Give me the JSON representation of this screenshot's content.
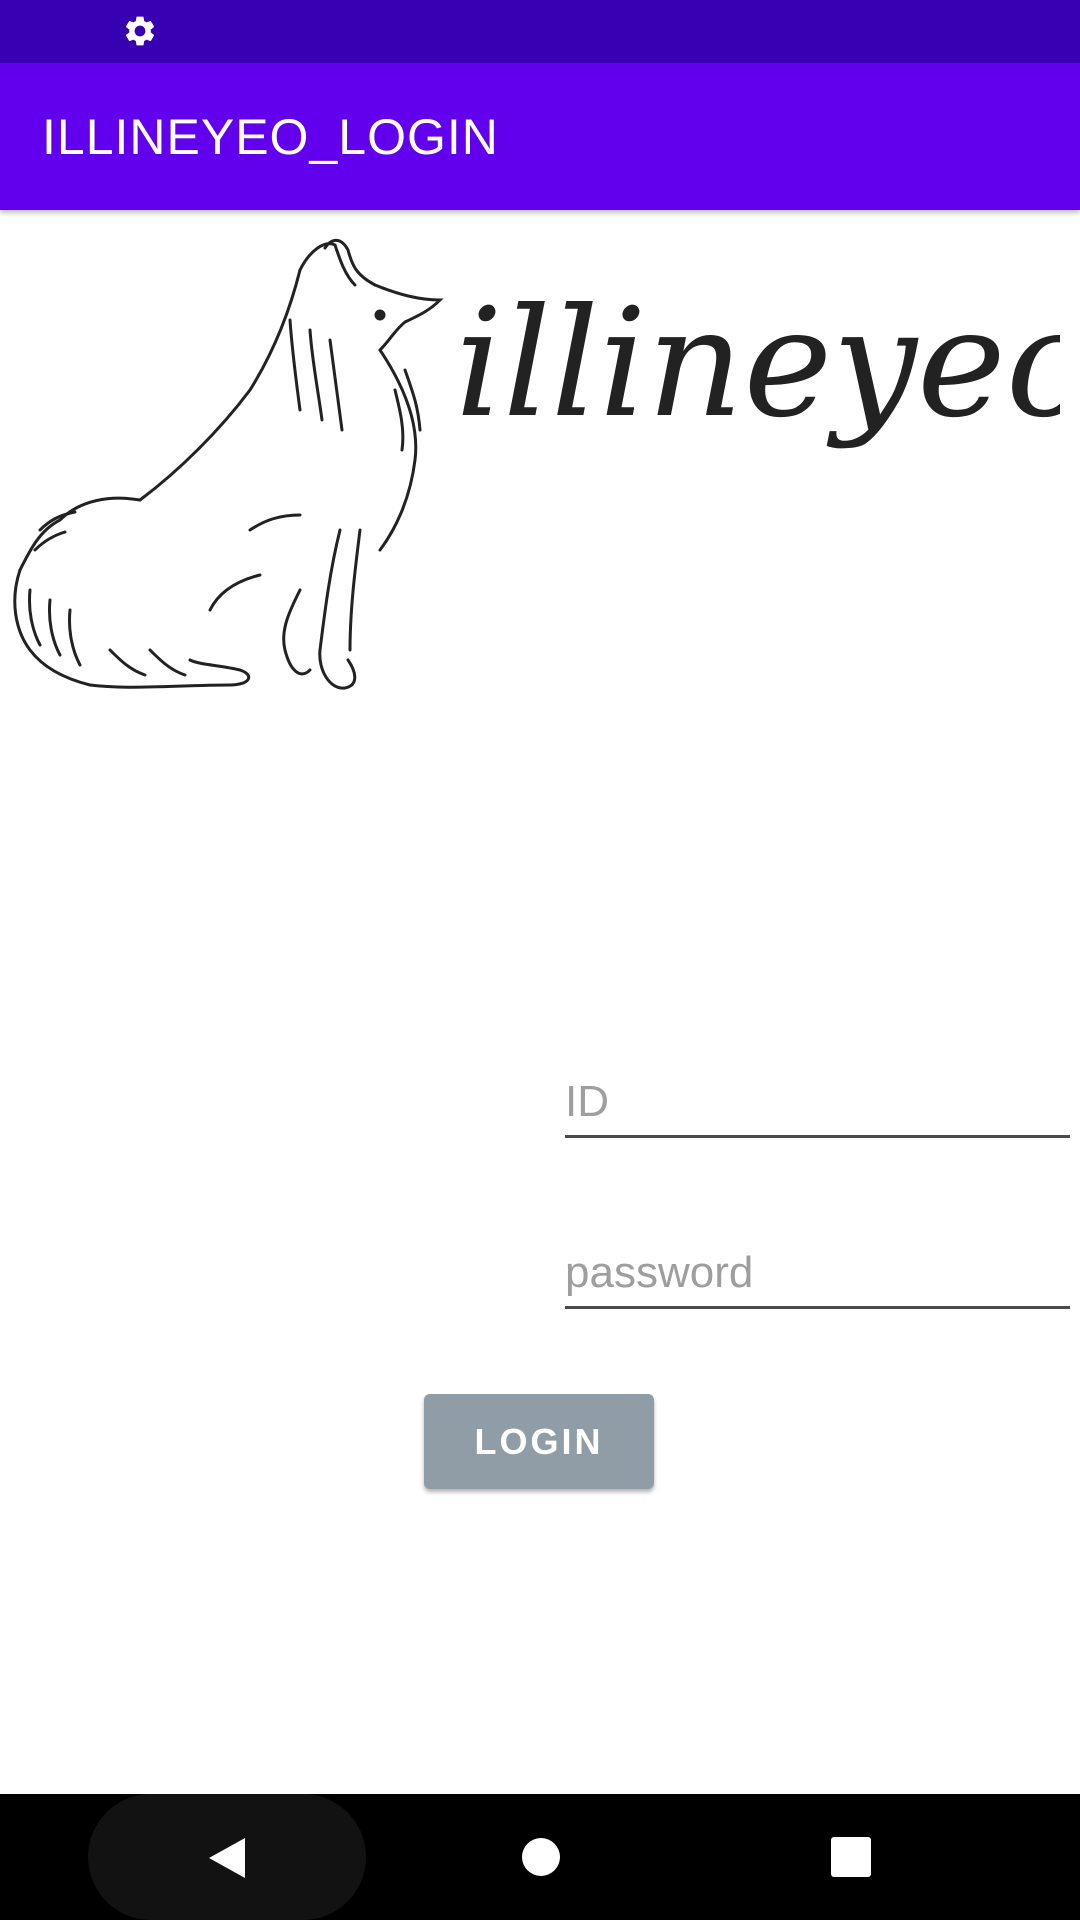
{
  "status_bar": {
    "icon": "gear-icon",
    "color": "#3700b3"
  },
  "app_bar": {
    "title": "ILLINEYEO_LOGIN",
    "color": "#6200ee"
  },
  "logo": {
    "wordmark": "illineyeo",
    "icon": "dog-sketch-logo"
  },
  "form": {
    "id_placeholder": "ID",
    "id_value": "",
    "password_placeholder": "password",
    "password_value": "",
    "login_label": "LOGIN",
    "login_button_color": "#909ca6"
  },
  "nav_bar": {
    "back": "back-icon",
    "home": "home-icon",
    "recents": "recents-icon"
  }
}
